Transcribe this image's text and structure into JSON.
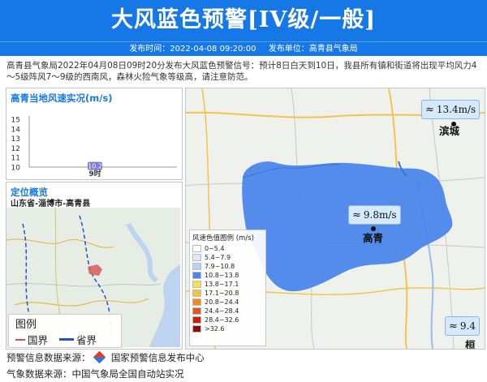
{
  "header": {
    "title": "大风蓝色预警[IV级/一般]",
    "publish_time": "发布时间：2022-04-08 09:20:00",
    "publisher": "发布单位：高青县气象局"
  },
  "description": "高青县气象局2022年04月08日09时20分发布大风蓝色预警信号：预计8日白天到10日，我县所有镇和街道将出现平均风力4～5级阵风7～9级的西南风，森林火险气象等级高，请注意防范。",
  "wind_panel": {
    "title": "高青当地风速实况(m/s)",
    "chart_data": {
      "type": "bar",
      "categories": [
        "9时"
      ],
      "values": [
        10.2
      ],
      "data_labels": [
        "10.2"
      ],
      "ylim": [
        10,
        15
      ],
      "yticks": [
        "15",
        "14",
        "13",
        "12",
        "11",
        "10"
      ]
    }
  },
  "location_panel": {
    "title": "定位概览",
    "location": "山东省-淄博市-高青县",
    "legend_title": "图例",
    "legend_items": [
      {
        "label": "国界",
        "color": "#c8506a"
      },
      {
        "label": "省界",
        "color": "#2b4fc8"
      }
    ]
  },
  "map": {
    "legend_title": "风速色值图例 (m/s)",
    "legend_items": [
      {
        "label": "0~5.4",
        "color": "#ffffff"
      },
      {
        "label": "5.4~7.9",
        "color": "#dbe8f8"
      },
      {
        "label": "7.9~10.8",
        "color": "#b8d3f3"
      },
      {
        "label": "10.8~13.8",
        "color": "#4a86ea"
      },
      {
        "label": "13.8~17.1",
        "color": "#f3e14b"
      },
      {
        "label": "17.1~20.8",
        "color": "#f5c23d"
      },
      {
        "label": "20.8~24.4",
        "color": "#f08a22"
      },
      {
        "label": "24.4~28.4",
        "color": "#e4561c"
      },
      {
        "label": "28.4~32.6",
        "color": "#c2240e"
      },
      {
        "label": ">32.6",
        "color": "#8a0c0c"
      }
    ],
    "stations": [
      {
        "name": "滨城",
        "speed": "13.4m/s"
      },
      {
        "name": "高青",
        "speed": "9.8m/s"
      },
      {
        "name": "桓",
        "speed": "9.4"
      }
    ]
  },
  "footer": {
    "warning_source": "预警信息数据来源：",
    "warning_source_name": "国家预警信息发布中心",
    "weather_source": "气象数据来源：中国气象局全国自动站实况"
  },
  "colors": {
    "banner": "#1677e6",
    "wind_area": "#4a86ea",
    "accent": "#1677e6"
  }
}
